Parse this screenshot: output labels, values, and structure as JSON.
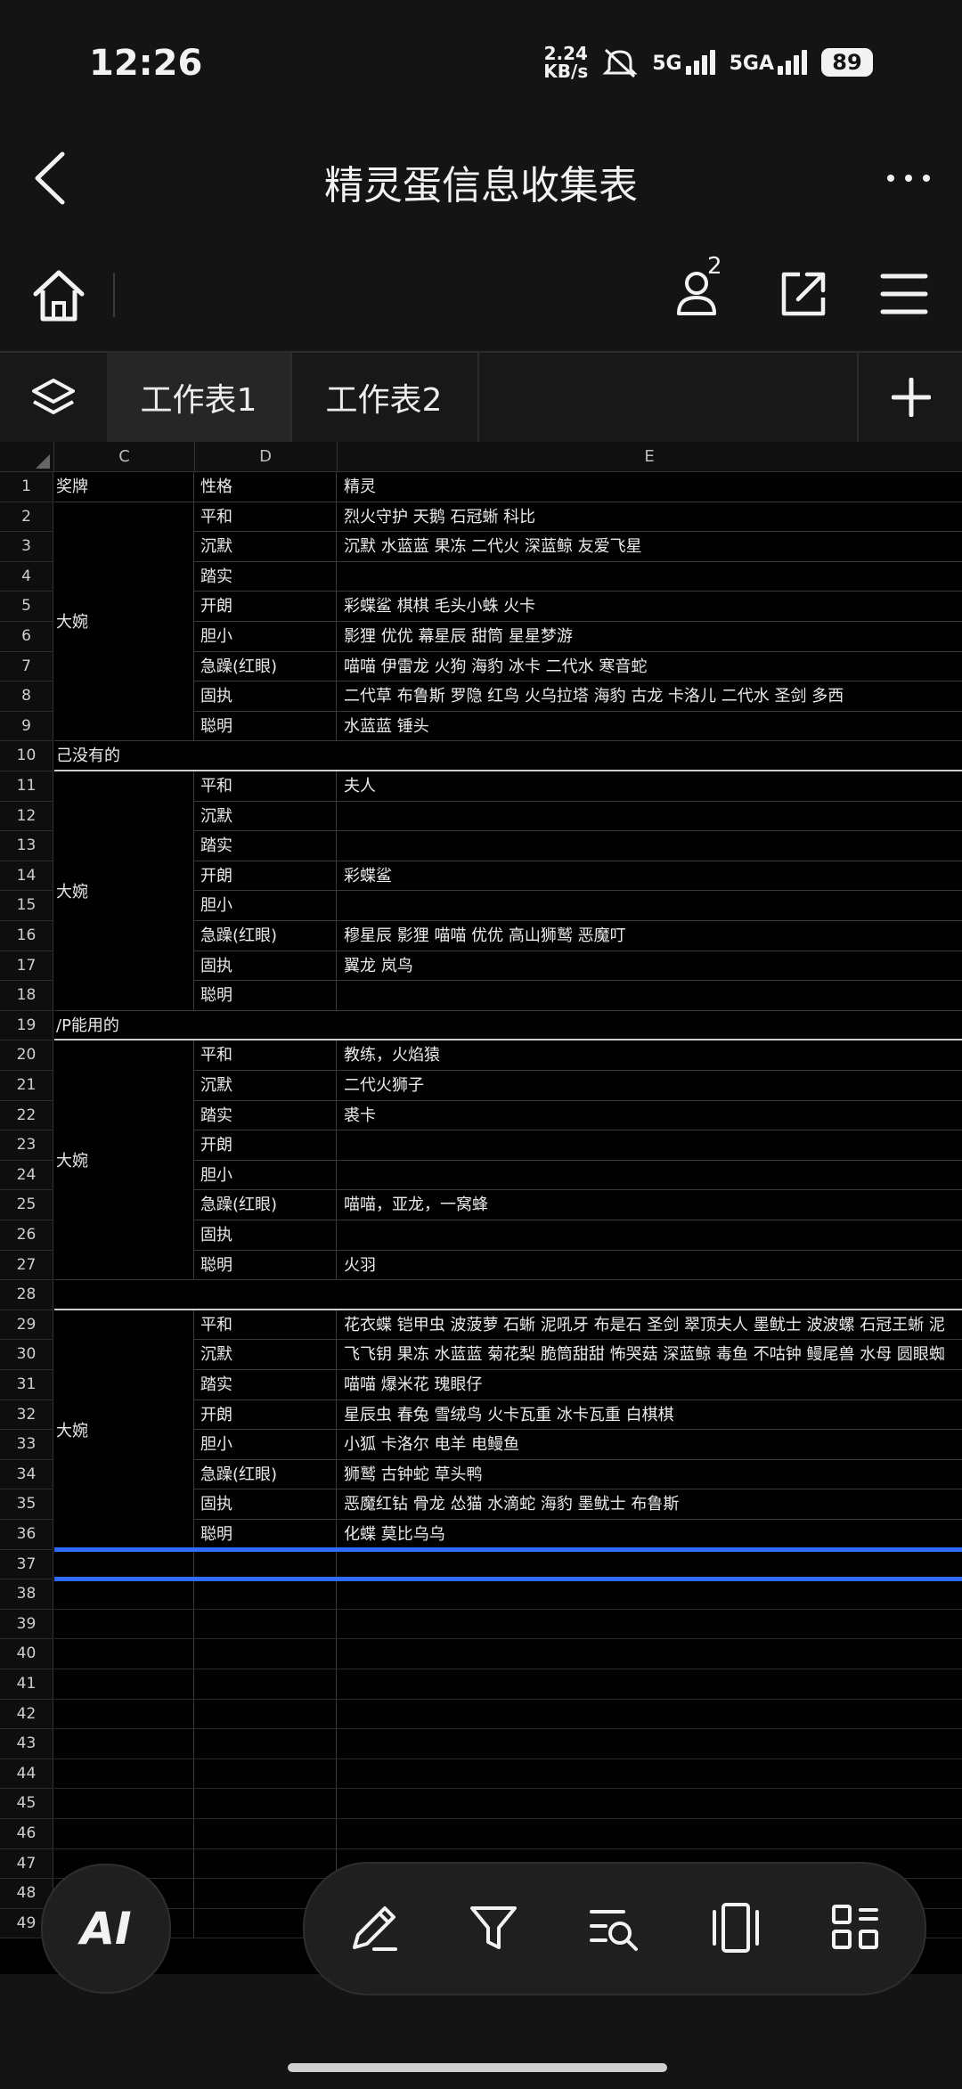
{
  "status": {
    "time": "12:26",
    "speed_value": "2.24",
    "speed_unit": "KB/s",
    "net1": "5G",
    "net2": "5GA",
    "battery": "89"
  },
  "header": {
    "title": "精灵蛋信息收集表"
  },
  "tabs": [
    {
      "label": "工作表1"
    },
    {
      "label": "工作表2"
    }
  ],
  "collab_count": "2",
  "columns": [
    "C",
    "D",
    "E"
  ],
  "rows": [
    {
      "n": "1",
      "c": "奖牌",
      "d": "性格",
      "e": "精灵"
    },
    {
      "n": "2",
      "c": "",
      "d": "平和",
      "e": "烈火守护 天鹅 石冠蜥 科比"
    },
    {
      "n": "3",
      "c": "",
      "d": "沉默",
      "e": "沉默 水蓝蓝 果冻 二代火 深蓝鲸 友爱飞星"
    },
    {
      "n": "4",
      "c": "",
      "d": "踏实",
      "e": ""
    },
    {
      "n": "5",
      "c": "",
      "d": "开朗",
      "e": "彩蝶鲨 棋棋 毛头小蛛 火卡"
    },
    {
      "n": "6",
      "c": "",
      "d": "胆小",
      "e": "影狸 优优 幕星辰 甜筒 星星梦游"
    },
    {
      "n": "7",
      "c": "",
      "d": "急躁(红眼)",
      "e": "喵喵 伊雷龙 火狗 海豹 冰卡 二代水 寒音蛇"
    },
    {
      "n": "8",
      "c": "",
      "d": "固执",
      "e": "二代草 布鲁斯 罗隐 红鸟 火乌拉塔 海豹 古龙 卡洛儿 二代水 圣剑 多西"
    },
    {
      "n": "9",
      "c": "",
      "d": "聪明",
      "e": "水蓝蓝 锤头"
    },
    {
      "n": "10",
      "full": "己没有的"
    },
    {
      "n": "11",
      "c": "",
      "d": "平和",
      "e": "夫人"
    },
    {
      "n": "12",
      "c": "",
      "d": "沉默",
      "e": ""
    },
    {
      "n": "13",
      "c": "",
      "d": "踏实",
      "e": ""
    },
    {
      "n": "14",
      "c": "",
      "d": "开朗",
      "e": "彩蝶鲨"
    },
    {
      "n": "15",
      "c": "",
      "d": "胆小",
      "e": ""
    },
    {
      "n": "16",
      "c": "",
      "d": "急躁(红眼)",
      "e": "穆星辰 影狸 喵喵 优优 高山狮鹫 恶魔叮"
    },
    {
      "n": "17",
      "c": "",
      "d": "固执",
      "e": "翼龙 岚鸟"
    },
    {
      "n": "18",
      "c": "",
      "d": "聪明",
      "e": ""
    },
    {
      "n": "19",
      "full": "/P能用的"
    },
    {
      "n": "20",
      "c": "",
      "d": "平和",
      "e": "教练，火焰猿"
    },
    {
      "n": "21",
      "c": "",
      "d": "沉默",
      "e": "二代火狮子"
    },
    {
      "n": "22",
      "c": "",
      "d": "踏实",
      "e": "裘卡"
    },
    {
      "n": "23",
      "c": "",
      "d": "开朗",
      "e": ""
    },
    {
      "n": "24",
      "c": "",
      "d": "胆小",
      "e": ""
    },
    {
      "n": "25",
      "c": "",
      "d": "急躁(红眼)",
      "e": "喵喵，亚龙，一窝蜂"
    },
    {
      "n": "26",
      "c": "",
      "d": "固执",
      "e": ""
    },
    {
      "n": "27",
      "c": "",
      "d": "聪明",
      "e": "火羽"
    },
    {
      "n": "28",
      "full": ""
    },
    {
      "n": "29",
      "c": "",
      "d": "平和",
      "e": "花衣蝶 铠甲虫 波菠萝 石蜥 泥吼牙 布是石 圣剑 翠顶夫人 墨鱿士 波波螺 石冠王蜥 泥"
    },
    {
      "n": "30",
      "c": "",
      "d": "沉默",
      "e": "飞飞钥 果冻 水蓝蓝 菊花梨 脆筒甜甜 怖哭菇 深蓝鲸 毒鱼 不咕钟 鳗尾兽 水母 圆眼蜘"
    },
    {
      "n": "31",
      "c": "",
      "d": "踏实",
      "e": "喵喵 爆米花 瑰眼仔"
    },
    {
      "n": "32",
      "c": "",
      "d": "开朗",
      "e": "星辰虫 春兔 雪绒鸟 火卡瓦重 冰卡瓦重 白棋棋"
    },
    {
      "n": "33",
      "c": "",
      "d": "胆小",
      "e": "小狐 卡洛尔 电羊 电鳗鱼"
    },
    {
      "n": "34",
      "c": "",
      "d": "急躁(红眼)",
      "e": "狮鹫 古钟蛇 草头鸭"
    },
    {
      "n": "35",
      "c": "",
      "d": "固执",
      "e": "恶魔红钻 骨龙 怂猫 水滴蛇 海豹 墨鱿士 布鲁斯"
    },
    {
      "n": "36",
      "c": "",
      "d": "聪明",
      "e": "化蝶 莫比乌乌"
    },
    {
      "n": "37"
    },
    {
      "n": "38"
    },
    {
      "n": "39"
    },
    {
      "n": "40"
    },
    {
      "n": "41"
    },
    {
      "n": "42"
    },
    {
      "n": "43"
    },
    {
      "n": "44"
    },
    {
      "n": "45"
    },
    {
      "n": "46"
    },
    {
      "n": "47"
    },
    {
      "n": "48"
    },
    {
      "n": "49"
    }
  ],
  "merged_labels": [
    {
      "text": "大婉",
      "start": 2,
      "end": 9
    },
    {
      "text": "大婉",
      "start": 11,
      "end": 18
    },
    {
      "text": "大婉",
      "start": 20,
      "end": 27
    },
    {
      "text": "大婉",
      "start": 29,
      "end": 36
    }
  ],
  "bottom": {
    "ai_label": "AI"
  }
}
